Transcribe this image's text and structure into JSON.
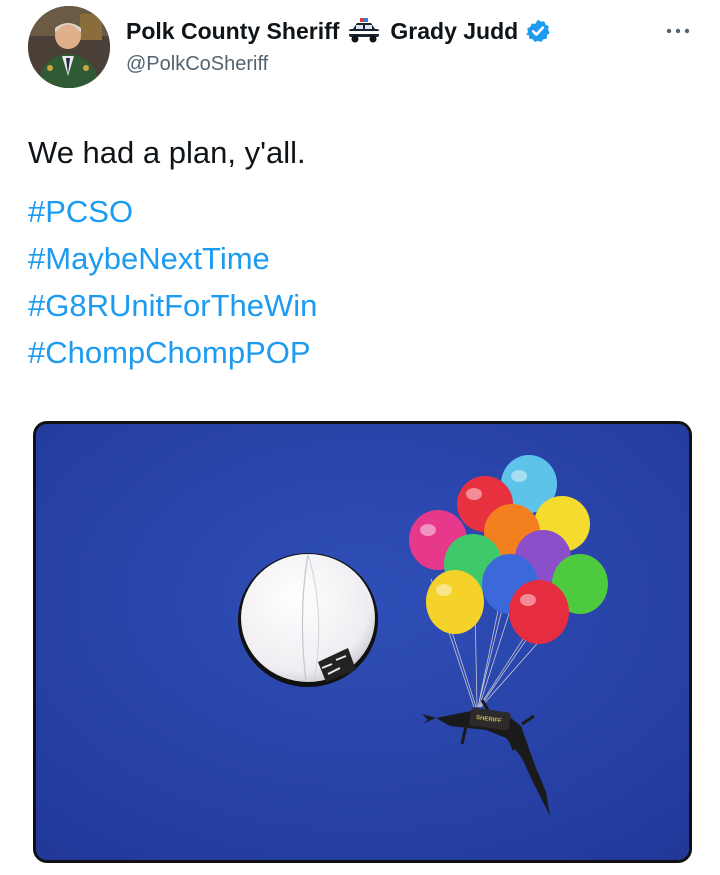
{
  "tweet": {
    "author_name": "Polk County Sheriff",
    "author_name_suffix": "Grady Judd",
    "handle": "@PolkCoSheriff",
    "icons": {
      "badge": "police-car-icon",
      "verified": "verified-badge-icon",
      "menu": "more-options-icon"
    },
    "text_lines": [
      "We had a plan, y'all."
    ],
    "hashtags": [
      "#PCSO",
      "#MaybeNextTime",
      "#G8RUnitForTheWin",
      "#ChompChompPOP"
    ],
    "media": {
      "colors": {
        "sky": "#2a45a8",
        "balloon": "#f4f4f6"
      },
      "alligator_vest_text": "SHERIFF"
    }
  },
  "colors": {
    "link": "#1d9bf0",
    "secondary_text": "#536471",
    "verified": "#1d9bf0"
  }
}
